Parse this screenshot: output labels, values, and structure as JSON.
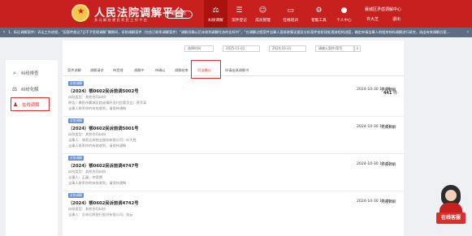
{
  "header": {
    "title": "人民法院调解平台",
    "subtitle": "多 元 解 纷   便 民 利 民   工 作 平 台",
    "return_label": "返回首页",
    "nav": [
      {
        "label": "纠纷调解",
        "icon": "gavel-icon",
        "active": true
      },
      {
        "label": "案件登记",
        "icon": "document-icon"
      },
      {
        "label": "成员管理",
        "icon": "users-icon"
      },
      {
        "label": "在线培训",
        "icon": "monitor-icon"
      },
      {
        "label": "智能工具",
        "icon": "tools-icon"
      },
      {
        "label": "个人中心",
        "icon": "person-icon"
      }
    ],
    "user": {
      "org": "襄城区矛盾调解中心",
      "name": "许大芝",
      "logout": "退出"
    }
  },
  "notice": {
    "text": "1、拆迁调解案件）诉讼工作进程，“因案件超过7日不予受理调解”属期间，诉前调解案件（包含已联系调解案件）“调解员确认后未收到调解任务的告知书”，“在调解过程案件当事人直接收集证据及分析案件各阶段处理流程的进度，确定申请当事人的相关材料调解进行研究，选出有效调解方案..."
  },
  "sidebar": {
    "items": [
      {
        "label": "纠纷排查",
        "icon": "search-icon"
      },
      {
        "label": "纠纷化解",
        "icon": "scale-icon"
      },
      {
        "label": "在线调解",
        "icon": "mediation-icon",
        "active": true
      }
    ]
  },
  "filters": {
    "select1": "选择时间",
    "date_start": "2025-11-01",
    "date_end": "2024-10-31",
    "keyword": "请输入案件/案号"
  },
  "tabs": [
    "案件调解",
    "调解请求",
    "待受理",
    "调解中",
    "待确认",
    "调解结束",
    "司法确认",
    "申请出具调解书"
  ],
  "count": {
    "value": "441",
    "unit": "件"
  },
  "cases": [
    {
      "type": "诉前调解",
      "title": "（2024）鄂0602民诉前调5002号",
      "time": "2024-10-30 11:48",
      "status": "完成调解",
      "case_type_label": "纠纷类型：",
      "case_type": "其他合同纠纷",
      "plaintiff_label": "原告：",
      "plaintiff": "襄阳市襄城区欧庙镇卧龙村民委员会；黄军某",
      "defendant": "当事人联系你的有效收到，请保持通畅"
    },
    {
      "type": "诉前调解",
      "title": "（2024）鄂0602民诉前调5001号",
      "time": "2024-10-30 11:43",
      "status": "完成调解",
      "case_type_label": "纠纷类型：",
      "case_type": "其他合同纠纷",
      "plaintiff_label": "当事人：",
      "plaintiff": "湖北达邦物业服务有限公司；叶大胜",
      "defendant": "当事人联系你的有效收到，请保持通畅"
    },
    {
      "type": "诉前调解",
      "title": "（2024）鄂0602民诉前调4747号",
      "time": "2024-10-30 11:42",
      "status": "完成调解",
      "case_type_label": "纠纷类型：",
      "case_type": "其他合同纠纷",
      "plaintiff_label": "当事人：",
      "plaintiff": "王巍；李德博",
      "defendant": "当事人联系你的有效收到，请保持通畅"
    },
    {
      "type": "诉前调解",
      "title": "（2024）鄂0602民诉前调4742号",
      "time": "2024-10-30 11:40",
      "status": "完成调解",
      "case_type_label": "纠纷类型：",
      "case_type": "其他合同纠纷",
      "plaintiff_label": "当事人：",
      "plaintiff": "吉林亿联银行股份有限公司；张云",
      "defendant": ""
    }
  ],
  "service": {
    "label": "在线客服"
  }
}
